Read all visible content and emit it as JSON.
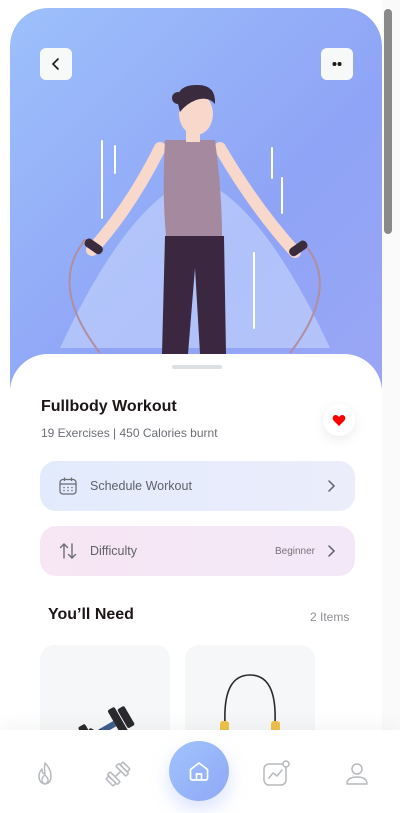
{
  "workout": {
    "title": "Fullbody Workout",
    "subtitle": "19 Exercises | 450 Calories burnt"
  },
  "actions": {
    "schedule_label": "Schedule Workout",
    "difficulty_label": "Difficulty",
    "difficulty_value": "Beginner"
  },
  "needs": {
    "title": "You’ll Need",
    "count": "2 Items"
  },
  "icons": {
    "back": "chevron-left-icon",
    "more": "more-dots-icon",
    "favorite": "heart-icon",
    "calendar": "calendar-icon",
    "difficulty": "swap-vertical-icon"
  },
  "colors": {
    "accent": "#92A3FD",
    "heart": "#ff0000",
    "text": "#1d1617"
  }
}
